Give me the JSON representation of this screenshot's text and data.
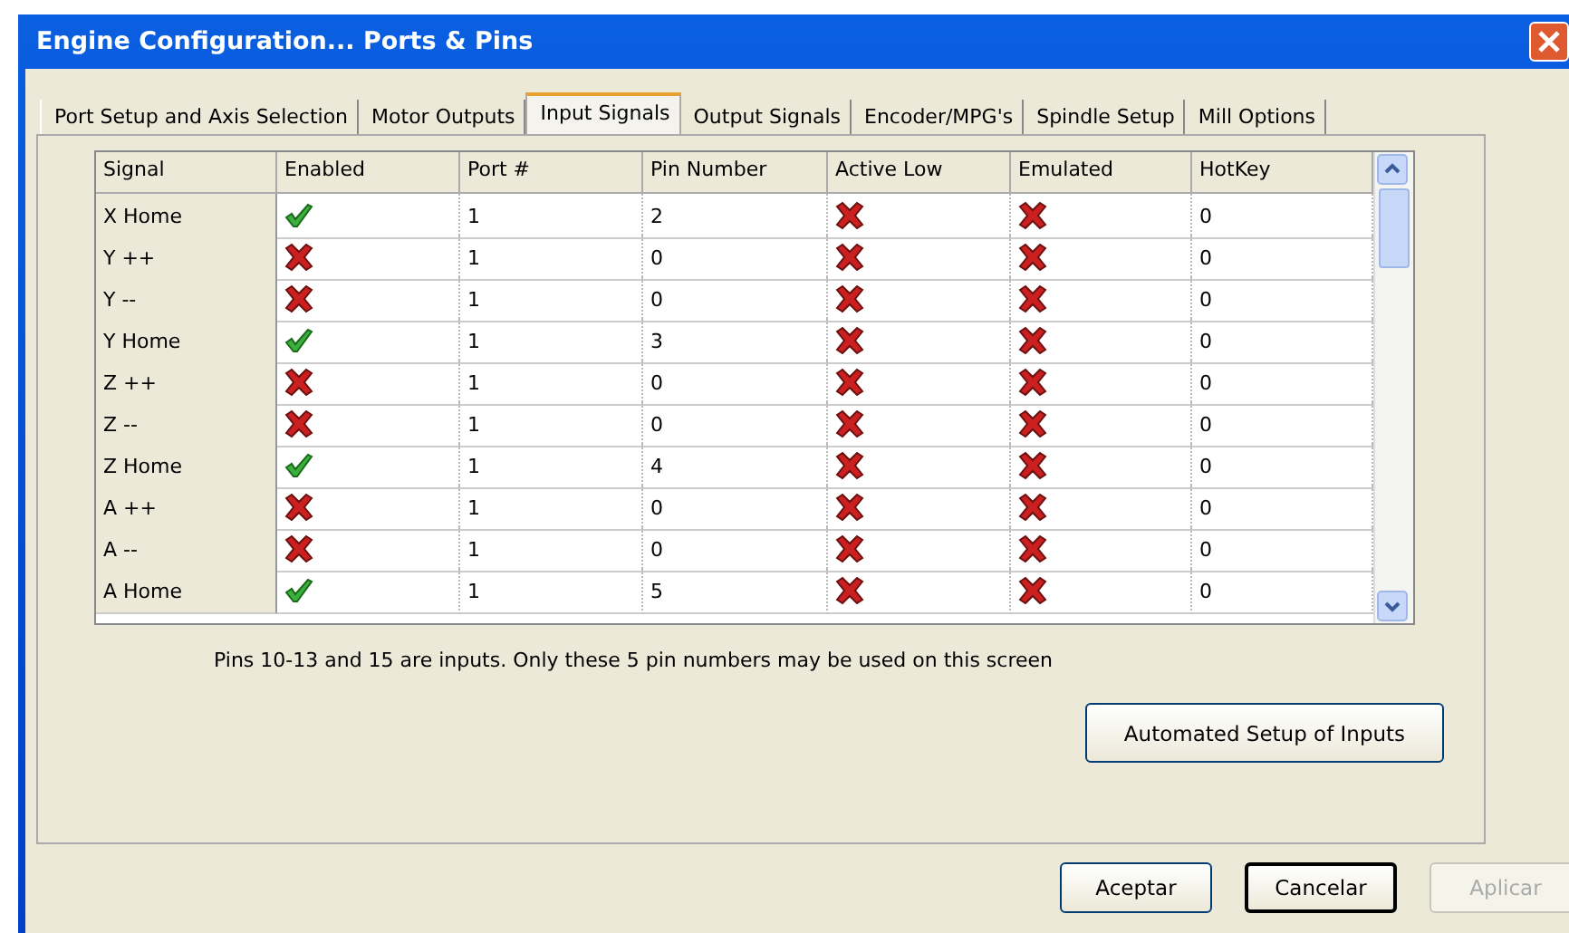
{
  "window": {
    "title": "Engine Configuration... Ports & Pins"
  },
  "tabs": [
    {
      "label": "Port Setup and Axis Selection",
      "selected": false
    },
    {
      "label": "Motor Outputs",
      "selected": false
    },
    {
      "label": "Input Signals",
      "selected": true
    },
    {
      "label": "Output Signals",
      "selected": false
    },
    {
      "label": "Encoder/MPG's",
      "selected": false
    },
    {
      "label": "Spindle Setup",
      "selected": false
    },
    {
      "label": "Mill Options",
      "selected": false
    }
  ],
  "table": {
    "columns": [
      "Signal",
      "Enabled",
      "Port #",
      "Pin Number",
      "Active Low",
      "Emulated",
      "HotKey"
    ],
    "rows": [
      {
        "signal": "X Home",
        "enabled": true,
        "port": "1",
        "pin": "2",
        "active_low": false,
        "emulated": false,
        "hotkey": "0"
      },
      {
        "signal": "Y ++",
        "enabled": false,
        "port": "1",
        "pin": "0",
        "active_low": false,
        "emulated": false,
        "hotkey": "0"
      },
      {
        "signal": "Y --",
        "enabled": false,
        "port": "1",
        "pin": "0",
        "active_low": false,
        "emulated": false,
        "hotkey": "0"
      },
      {
        "signal": "Y Home",
        "enabled": true,
        "port": "1",
        "pin": "3",
        "active_low": false,
        "emulated": false,
        "hotkey": "0"
      },
      {
        "signal": "Z ++",
        "enabled": false,
        "port": "1",
        "pin": "0",
        "active_low": false,
        "emulated": false,
        "hotkey": "0"
      },
      {
        "signal": "Z --",
        "enabled": false,
        "port": "1",
        "pin": "0",
        "active_low": false,
        "emulated": false,
        "hotkey": "0"
      },
      {
        "signal": "Z Home",
        "enabled": true,
        "port": "1",
        "pin": "4",
        "active_low": false,
        "emulated": false,
        "hotkey": "0"
      },
      {
        "signal": "A ++",
        "enabled": false,
        "port": "1",
        "pin": "0",
        "active_low": false,
        "emulated": false,
        "hotkey": "0"
      },
      {
        "signal": "A --",
        "enabled": false,
        "port": "1",
        "pin": "0",
        "active_low": false,
        "emulated": false,
        "hotkey": "0"
      },
      {
        "signal": "A Home",
        "enabled": true,
        "port": "1",
        "pin": "5",
        "active_low": false,
        "emulated": false,
        "hotkey": "0"
      }
    ]
  },
  "note": "Pins 10-13 and 15 are inputs. Only these 5 pin numbers may be used on this screen",
  "setup_button": "Automated Setup of Inputs",
  "buttons": [
    {
      "label": "Aceptar",
      "disabled": false,
      "default": false
    },
    {
      "label": "Cancelar",
      "disabled": false,
      "default": true
    },
    {
      "label": "Aplicar",
      "disabled": true,
      "default": false
    }
  ]
}
